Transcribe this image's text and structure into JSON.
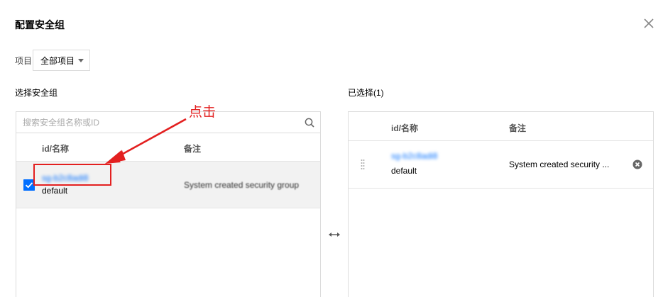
{
  "dialog": {
    "title": "配置安全组"
  },
  "project": {
    "label": "项目",
    "selected": "全部项目"
  },
  "left_panel": {
    "section_label": "选择安全组",
    "search_placeholder": "搜索安全组名称或ID",
    "columns": [
      "id/名称",
      "备注"
    ],
    "rows": [
      {
        "id": "sg-b2c8adi8",
        "name": "default",
        "remark": "System created security group",
        "checked": true
      }
    ]
  },
  "right_panel": {
    "section_label": "已选择(1)",
    "columns": [
      "id/名称",
      "备注"
    ],
    "rows": [
      {
        "id": "sg-b2c8adi8",
        "name": "default",
        "remark": "System created security ..."
      }
    ]
  },
  "annotation": {
    "text": "点击",
    "color": "#e32020"
  },
  "colors": {
    "accent": "#006eff",
    "border": "#dcdcdc",
    "selected_row_bg": "#f2f2f2"
  },
  "icons": [
    "close-icon",
    "caret-down-icon",
    "search-icon",
    "checkbox-checked-icon",
    "swap-arrows-icon",
    "drag-handle-icon",
    "remove-circle-icon"
  ]
}
